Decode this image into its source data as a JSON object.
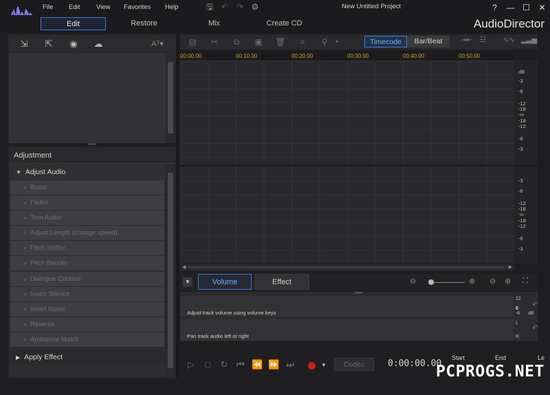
{
  "menu": [
    "File",
    "Edit",
    "View",
    "Favorites",
    "Help"
  ],
  "window": {
    "title": "New Untitled Project",
    "help": "?",
    "minimize": "—",
    "maximize": "☐",
    "close": "✕"
  },
  "modes": [
    "Edit",
    "Restore",
    "Mix",
    "Create CD"
  ],
  "brand": "AudioDirector",
  "media": {
    "font_btn": "Aᵀ▾"
  },
  "adjustment": {
    "header": "Adjustment",
    "group": "Adjust Audio",
    "items": [
      "Boost",
      "Fades",
      "Trim Audio",
      "Adjust Length (change speed)",
      "Pitch Shifter",
      "Pitch Bender",
      "Dialogue Contour",
      "Insert Silence",
      "Insert Noise",
      "Reverse",
      "Ambience Match"
    ],
    "apply": "Apply Effect"
  },
  "view_toggle": {
    "timecode": "Timecode",
    "barbeat": "Bar/Beat"
  },
  "timeline": [
    "00:00.00",
    "00:10.00",
    "00:20.00",
    "00:30.00",
    "00:40.00",
    "00:50.00"
  ],
  "db_unit": "dB",
  "db_scale": [
    "-3",
    "-6",
    "-12",
    "-18",
    "-∞",
    "-18",
    "-12",
    "-6",
    "-3"
  ],
  "fx_tabs": {
    "volume": "Volume",
    "effect": "Effect"
  },
  "tracks": {
    "volume_hint": "Adjust track volume using volume keys",
    "pan_hint": "Pan track audio left or right",
    "vol_scale": [
      "12",
      "0",
      "-6",
      "dB"
    ],
    "pan_scale": [
      "L",
      "R"
    ]
  },
  "transport": {
    "codec": "Codec",
    "timecode": "0:00:00.00",
    "start": "Start",
    "end": "End",
    "length": "Le"
  },
  "watermark": "PCPROGS.NET",
  "colors": {
    "accent": "#3e7bd8",
    "timeline_text": "#c9a227",
    "record": "#c81e1e"
  }
}
